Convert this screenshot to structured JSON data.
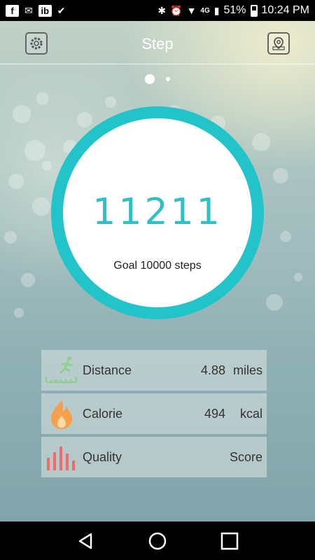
{
  "status_bar": {
    "left_icons": [
      "facebook-icon",
      "mail-icon",
      "ibotta-icon",
      "checklist-icon"
    ],
    "network": "4G",
    "battery": "51%",
    "time": "10:24 PM"
  },
  "header": {
    "title": "Step",
    "left_icon": "settings-icon",
    "right_icon": "map-pin-icon"
  },
  "pager": {
    "active_index": 0,
    "count": 2
  },
  "ring": {
    "steps": "11211",
    "goal": "Goal 10000 steps",
    "color": "#22c3c9"
  },
  "stats": [
    {
      "icon": "walking-distance-icon",
      "label": "Distance",
      "value": "4.88",
      "unit": "miles"
    },
    {
      "icon": "flame-icon",
      "label": "Calorie",
      "value": "494",
      "unit": "kcal"
    },
    {
      "icon": "bars-icon",
      "label": "Quality",
      "value": "",
      "unit": "Score"
    }
  ],
  "navbar": [
    "back-icon",
    "home-icon",
    "recents-icon"
  ]
}
